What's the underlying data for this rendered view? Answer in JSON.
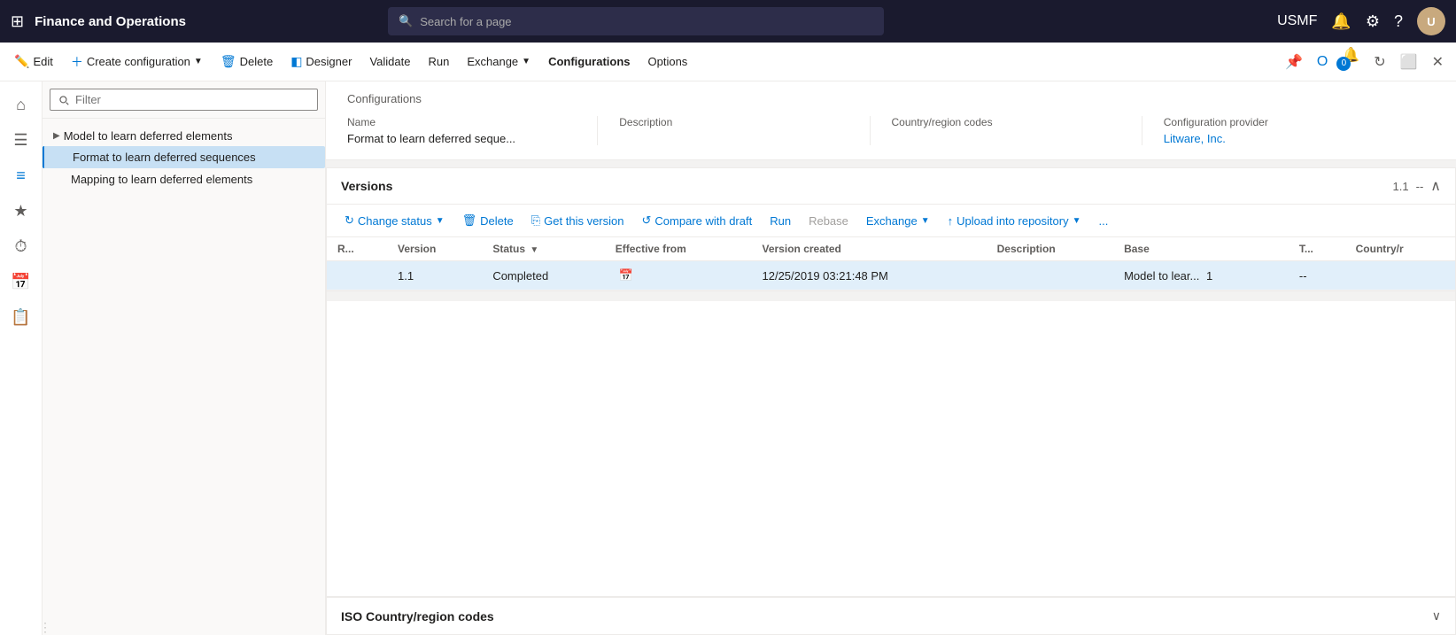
{
  "app": {
    "title": "Finance and Operations",
    "user": "USMF",
    "search_placeholder": "Search for a page"
  },
  "command_bar": {
    "edit": "Edit",
    "create_config": "Create configuration",
    "delete": "Delete",
    "designer": "Designer",
    "validate": "Validate",
    "run": "Run",
    "exchange": "Exchange",
    "configurations": "Configurations",
    "options": "Options"
  },
  "sidebar": {
    "filter_placeholder": "Filter"
  },
  "tree": {
    "parent": "Model to learn deferred elements",
    "children": [
      {
        "label": "Format to learn deferred sequences",
        "selected": true
      },
      {
        "label": "Mapping to learn deferred elements",
        "selected": false
      }
    ]
  },
  "config_header": {
    "section_title": "Configurations",
    "fields": {
      "name_label": "Name",
      "name_value": "Format to learn deferred seque...",
      "description_label": "Description",
      "description_value": "",
      "country_label": "Country/region codes",
      "country_value": "",
      "provider_label": "Configuration provider",
      "provider_value": "Litware, Inc."
    }
  },
  "versions": {
    "title": "Versions",
    "version_number": "1.1",
    "separator": "--",
    "toolbar": {
      "change_status": "Change status",
      "delete": "Delete",
      "get_this_version": "Get this version",
      "compare_with_draft": "Compare with draft",
      "run": "Run",
      "rebase": "Rebase",
      "exchange": "Exchange",
      "upload_into_repository": "Upload into repository",
      "more": "..."
    },
    "columns": [
      "R...",
      "Version",
      "Status",
      "Effective from",
      "Version created",
      "Description",
      "Base",
      "T...",
      "Country/r"
    ],
    "rows": [
      {
        "r": "",
        "version": "1.1",
        "status": "Completed",
        "effective_from": "",
        "version_created": "12/25/2019 03:21:48 PM",
        "description": "",
        "base": "Model to lear...",
        "base_version": "1",
        "t": "--",
        "country": ""
      }
    ]
  },
  "iso_section": {
    "title": "ISO Country/region codes"
  }
}
